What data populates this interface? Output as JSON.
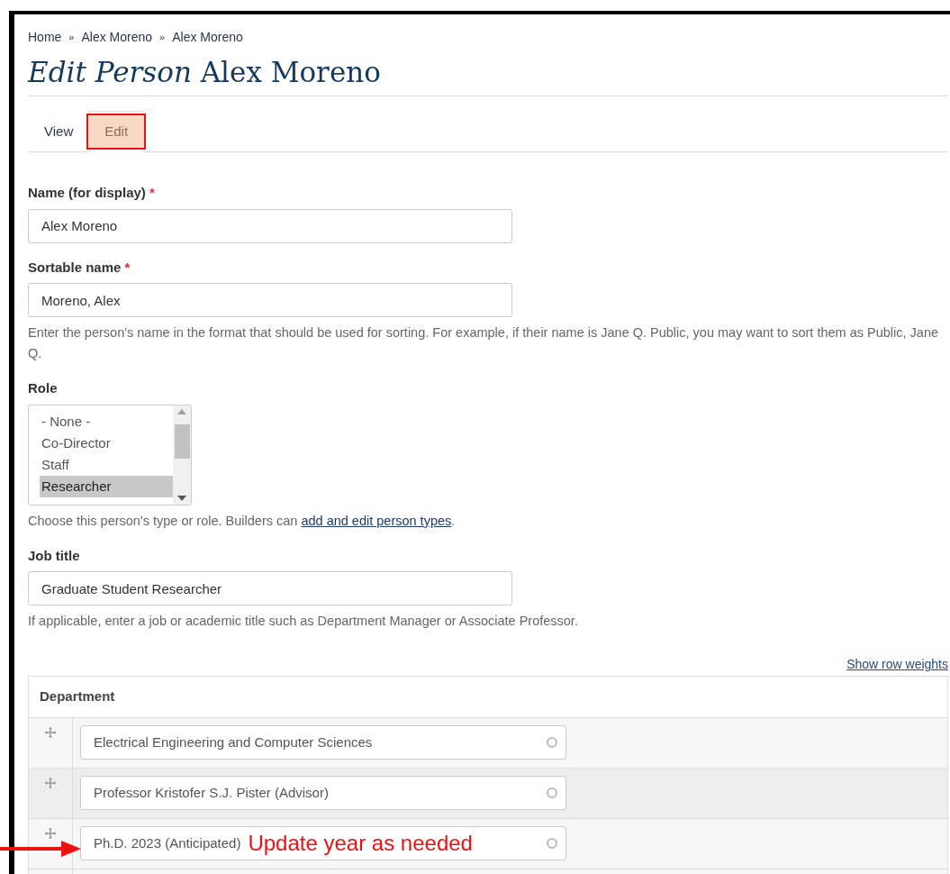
{
  "breadcrumb": [
    "Home",
    "Alex Moreno",
    "Alex Moreno"
  ],
  "breadcrumb_separator": "»",
  "title": {
    "prefix": "Edit Person",
    "name": "Alex Moreno"
  },
  "tabs": [
    {
      "label": "View",
      "selected": false,
      "highlighted": false
    },
    {
      "label": "Edit",
      "selected": true,
      "highlighted": true
    }
  ],
  "fields": [
    {
      "kind": "text",
      "label": "Name (for display)",
      "required": true,
      "value": "Alex Moreno"
    },
    {
      "kind": "text",
      "label": "Sortable name",
      "required": true,
      "value": "Moreno, Alex",
      "help": "Enter the person's name in the format that should be used for sorting. For example, if their name is Jane Q. Public, you may want to sort them as Public, Jane Q."
    },
    {
      "kind": "listbox",
      "label": "Role",
      "required": false,
      "options": [
        {
          "label": "- None -",
          "selected": false
        },
        {
          "label": "Co-Director",
          "selected": false
        },
        {
          "label": "Staff",
          "selected": false
        },
        {
          "label": "Researcher",
          "selected": true
        }
      ],
      "help": "Choose this person's type or role. Builders can ",
      "help_link": "add and edit person types",
      "help_end": "."
    },
    {
      "kind": "text",
      "label": "Job title",
      "required": false,
      "value": "Graduate Student Researcher",
      "help": "If applicable, enter a job or academic title such as Department Manager or Associate Professor."
    }
  ],
  "required_mark": "*",
  "show_row_weights": "Show row weights",
  "table": {
    "header": "Department",
    "rows": [
      {
        "value": "Electrical Engineering and Computer Sciences"
      },
      {
        "value": "Professor Kristofer S.J. Pister (Advisor)"
      },
      {
        "value": "Ph.D. 2023 (Anticipated)",
        "annotation": "Update year as needed"
      }
    ]
  }
}
